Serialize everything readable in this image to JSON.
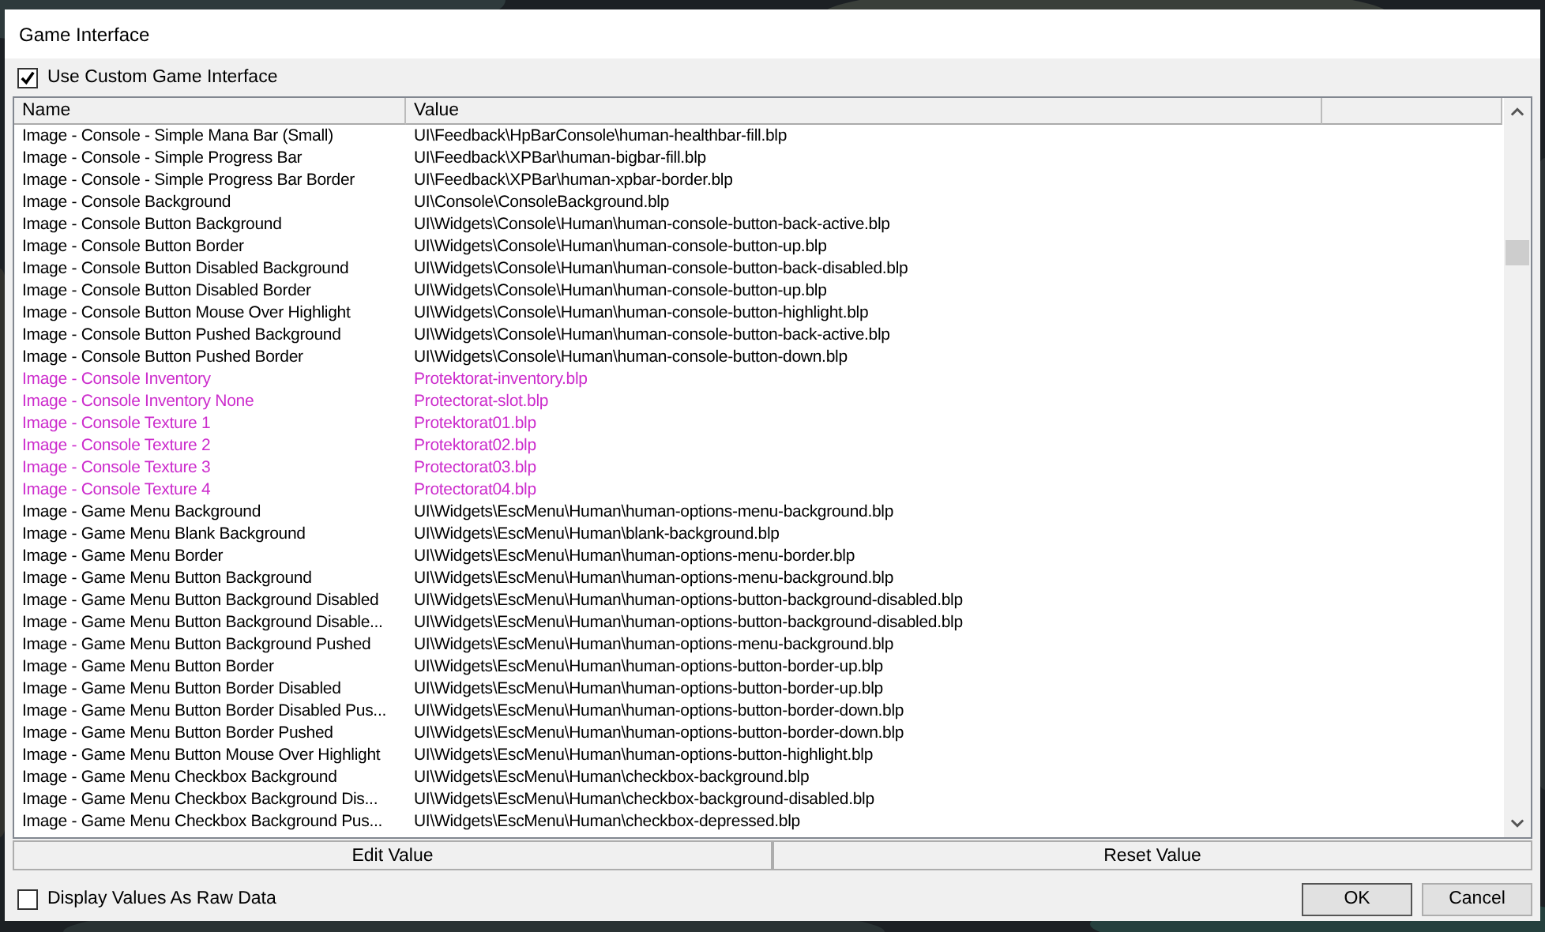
{
  "window": {
    "title": "Game Interface"
  },
  "use_custom": {
    "label": "Use Custom Game Interface",
    "checked": true
  },
  "table": {
    "columns": [
      "Name",
      "Value"
    ],
    "rows": [
      {
        "name": "Image - Console - Simple Mana Bar (Small)",
        "value": "UI\\Feedback\\HpBarConsole\\human-healthbar-fill.blp",
        "modified": false
      },
      {
        "name": "Image - Console - Simple Progress Bar",
        "value": "UI\\Feedback\\XPBar\\human-bigbar-fill.blp",
        "modified": false
      },
      {
        "name": "Image - Console - Simple Progress Bar Border",
        "value": "UI\\Feedback\\XPBar\\human-xpbar-border.blp",
        "modified": false
      },
      {
        "name": "Image - Console Background",
        "value": "UI\\Console\\ConsoleBackground.blp",
        "modified": false
      },
      {
        "name": "Image - Console Button Background",
        "value": "UI\\Widgets\\Console\\Human\\human-console-button-back-active.blp",
        "modified": false
      },
      {
        "name": "Image - Console Button Border",
        "value": "UI\\Widgets\\Console\\Human\\human-console-button-up.blp",
        "modified": false
      },
      {
        "name": "Image - Console Button Disabled Background",
        "value": "UI\\Widgets\\Console\\Human\\human-console-button-back-disabled.blp",
        "modified": false
      },
      {
        "name": "Image - Console Button Disabled Border",
        "value": "UI\\Widgets\\Console\\Human\\human-console-button-up.blp",
        "modified": false
      },
      {
        "name": "Image - Console Button Mouse Over Highlight",
        "value": "UI\\Widgets\\Console\\Human\\human-console-button-highlight.blp",
        "modified": false
      },
      {
        "name": "Image - Console Button Pushed Background",
        "value": "UI\\Widgets\\Console\\Human\\human-console-button-back-active.blp",
        "modified": false
      },
      {
        "name": "Image - Console Button Pushed Border",
        "value": "UI\\Widgets\\Console\\Human\\human-console-button-down.blp",
        "modified": false
      },
      {
        "name": "Image - Console Inventory",
        "value": "Protektorat-inventory.blp",
        "modified": true
      },
      {
        "name": "Image - Console Inventory None",
        "value": "Protectorat-slot.blp",
        "modified": true
      },
      {
        "name": "Image - Console Texture 1",
        "value": "Protektorat01.blp",
        "modified": true
      },
      {
        "name": "Image - Console Texture 2",
        "value": "Protektorat02.blp",
        "modified": true
      },
      {
        "name": "Image - Console Texture 3",
        "value": "Protectorat03.blp",
        "modified": true
      },
      {
        "name": "Image - Console Texture 4",
        "value": "Protectorat04.blp",
        "modified": true
      },
      {
        "name": "Image - Game Menu Background",
        "value": "UI\\Widgets\\EscMenu\\Human\\human-options-menu-background.blp",
        "modified": false
      },
      {
        "name": "Image - Game Menu Blank Background",
        "value": "UI\\Widgets\\EscMenu\\Human\\blank-background.blp",
        "modified": false
      },
      {
        "name": "Image - Game Menu Border",
        "value": "UI\\Widgets\\EscMenu\\Human\\human-options-menu-border.blp",
        "modified": false
      },
      {
        "name": "Image - Game Menu Button Background",
        "value": "UI\\Widgets\\EscMenu\\Human\\human-options-menu-background.blp",
        "modified": false
      },
      {
        "name": "Image - Game Menu Button Background Disabled",
        "value": "UI\\Widgets\\EscMenu\\Human\\human-options-button-background-disabled.blp",
        "modified": false
      },
      {
        "name": "Image - Game Menu Button Background Disable...",
        "value": "UI\\Widgets\\EscMenu\\Human\\human-options-button-background-disabled.blp",
        "modified": false
      },
      {
        "name": "Image - Game Menu Button Background Pushed",
        "value": "UI\\Widgets\\EscMenu\\Human\\human-options-menu-background.blp",
        "modified": false
      },
      {
        "name": "Image - Game Menu Button Border",
        "value": "UI\\Widgets\\EscMenu\\Human\\human-options-button-border-up.blp",
        "modified": false
      },
      {
        "name": "Image - Game Menu Button Border Disabled",
        "value": "UI\\Widgets\\EscMenu\\Human\\human-options-button-border-up.blp",
        "modified": false
      },
      {
        "name": "Image - Game Menu Button Border Disabled Pus...",
        "value": "UI\\Widgets\\EscMenu\\Human\\human-options-button-border-down.blp",
        "modified": false
      },
      {
        "name": "Image - Game Menu Button Border Pushed",
        "value": "UI\\Widgets\\EscMenu\\Human\\human-options-button-border-down.blp",
        "modified": false
      },
      {
        "name": "Image - Game Menu Button Mouse Over Highlight",
        "value": "UI\\Widgets\\EscMenu\\Human\\human-options-button-highlight.blp",
        "modified": false
      },
      {
        "name": "Image - Game Menu Checkbox Background",
        "value": "UI\\Widgets\\EscMenu\\Human\\checkbox-background.blp",
        "modified": false
      },
      {
        "name": "Image - Game Menu Checkbox Background Dis...",
        "value": "UI\\Widgets\\EscMenu\\Human\\checkbox-background-disabled.blp",
        "modified": false
      },
      {
        "name": "Image - Game Menu Checkbox Background Pus...",
        "value": "UI\\Widgets\\EscMenu\\Human\\checkbox-depressed.blp",
        "modified": false
      }
    ]
  },
  "actions": [
    "Edit Value",
    "Reset Value"
  ],
  "raw_data": {
    "label": "Display Values As Raw Data",
    "checked": false
  },
  "buttons": [
    "OK",
    "Cancel"
  ]
}
